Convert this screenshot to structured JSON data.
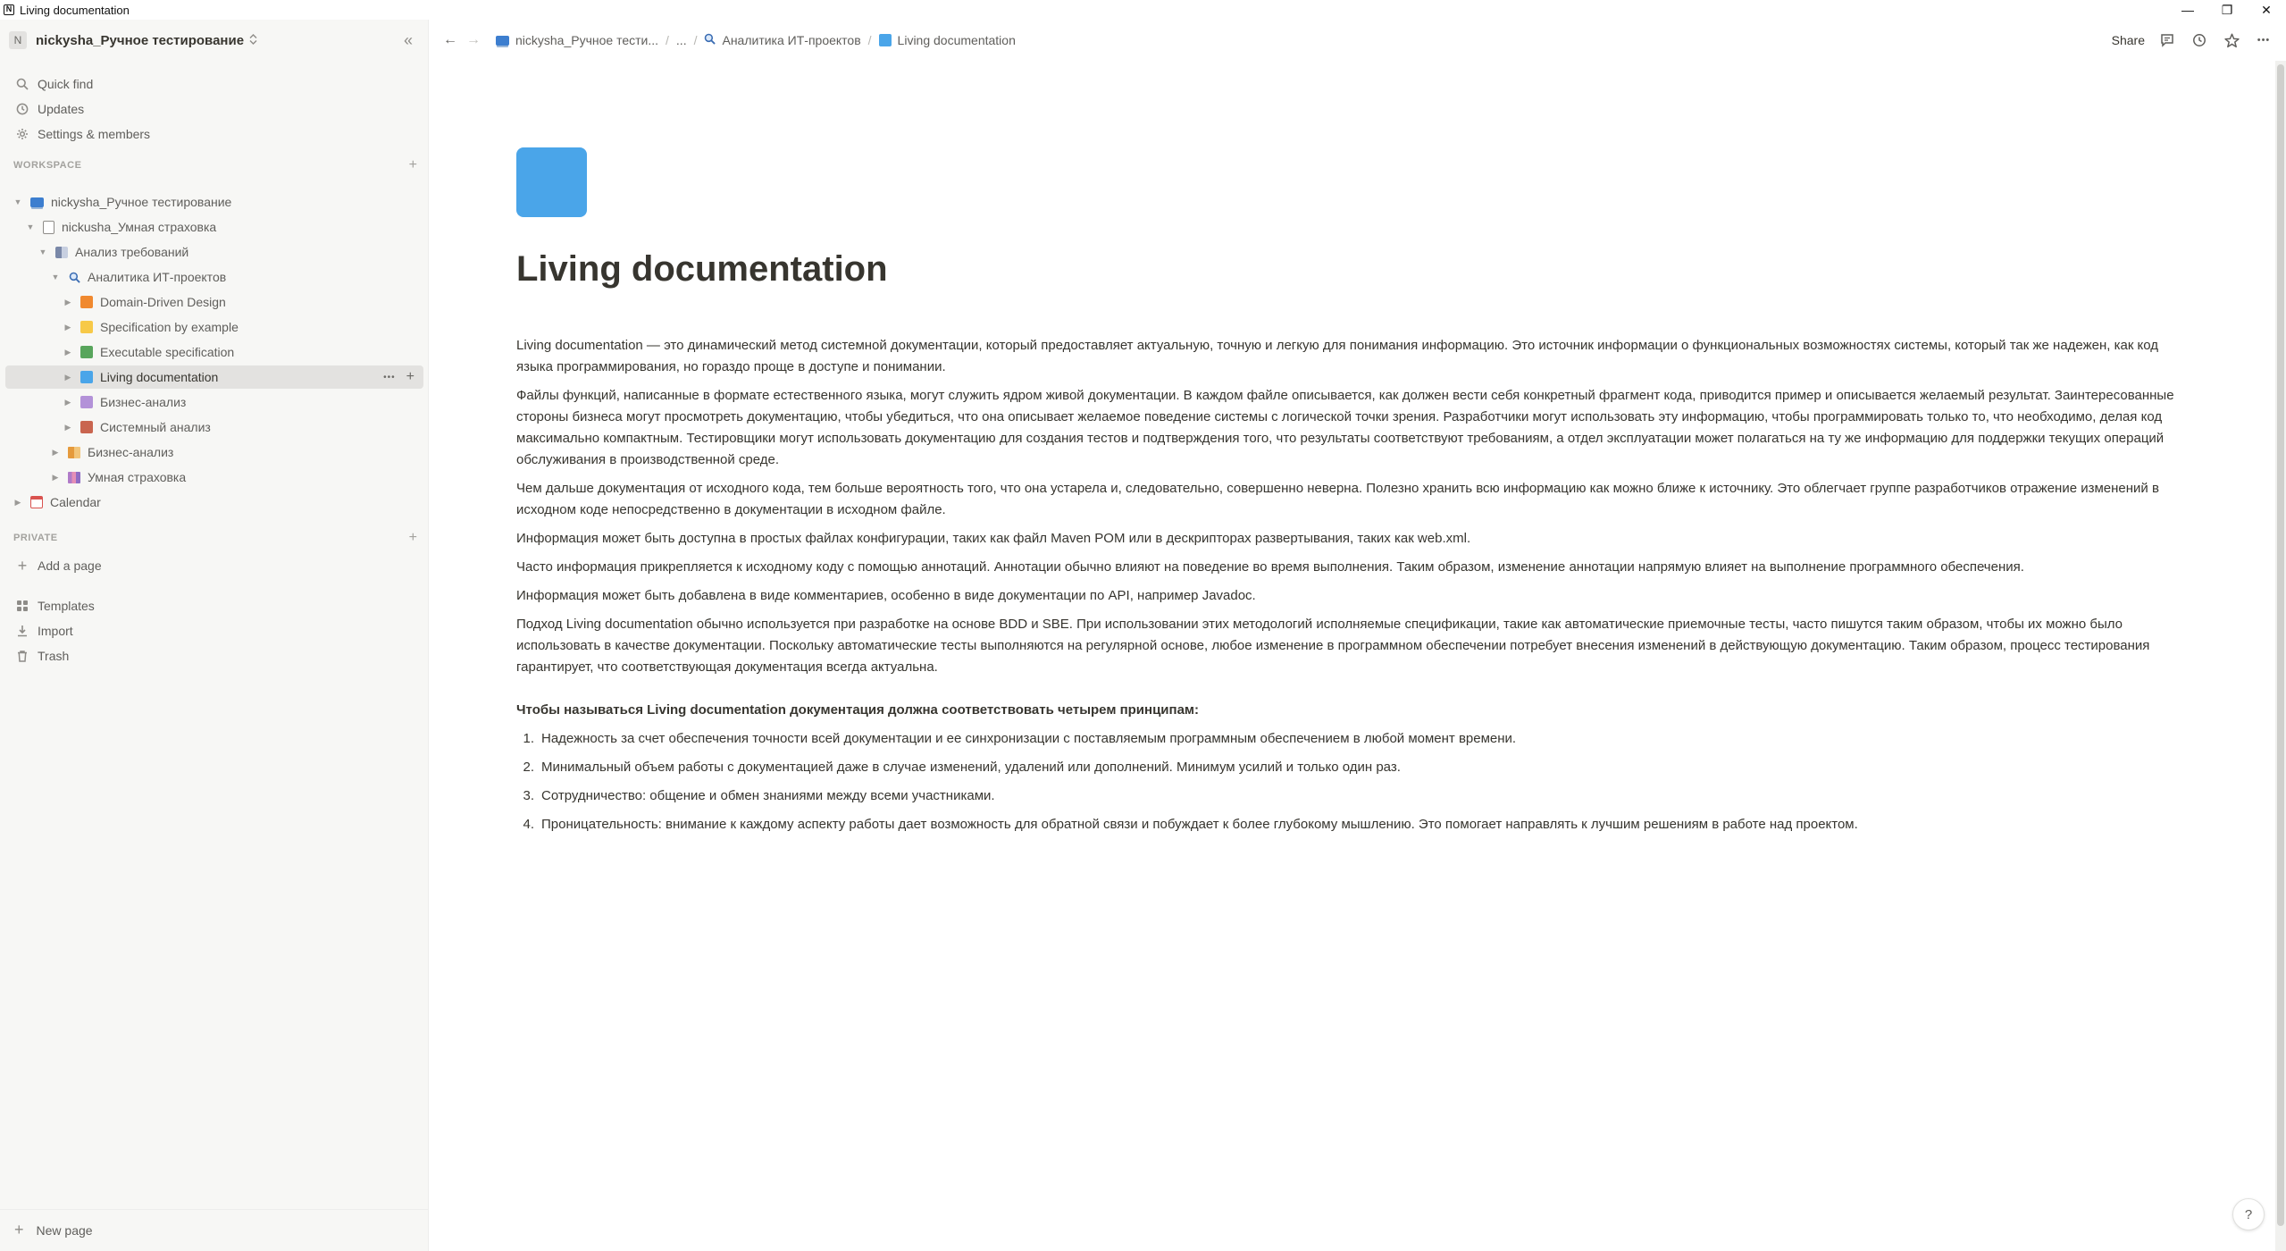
{
  "window": {
    "title": "Living documentation",
    "app_icon": "N",
    "controls": [
      "—",
      "❐",
      "✕"
    ]
  },
  "sidebar": {
    "workspace": {
      "avatar": "N",
      "name": "nickysha_Ручное тестирование",
      "chevron": "⌃⌄"
    },
    "collapse_icon": "«",
    "top_items": [
      {
        "label": "Quick find",
        "icon": "search-icon"
      },
      {
        "label": "Updates",
        "icon": "clock-icon"
      },
      {
        "label": "Settings & members",
        "icon": "gear-icon"
      }
    ],
    "workspace_section": {
      "label": "WORKSPACE",
      "plus": "+"
    },
    "tree": [
      {
        "label": "nickysha_Ручное тестирование"
      },
      {
        "label": "nickusha_Умная страховка"
      },
      {
        "label": "Анализ требований"
      },
      {
        "label": "Аналитика ИТ-проектов"
      },
      {
        "label": "Domain-Driven Design",
        "color": "#f0892f"
      },
      {
        "label": "Specification by example",
        "color": "#f7c948"
      },
      {
        "label": "Executable specification",
        "color": "#58a55c"
      },
      {
        "label": "Living documentation",
        "color": "#4aa5e9"
      },
      {
        "label": "Бизнес-анализ",
        "color": "#b392d8"
      },
      {
        "label": "Системный анализ",
        "color": "#c9654f"
      },
      {
        "label": "Бизнес-анализ"
      },
      {
        "label": "Умная страховка"
      },
      {
        "label": "Calendar"
      }
    ],
    "selected_actions": {
      "more": "•••",
      "add": "+"
    },
    "private_section": {
      "label": "PRIVATE",
      "plus": "+"
    },
    "add_page": {
      "label": "Add a page",
      "icon": "+"
    },
    "bottom_items": [
      {
        "label": "Templates",
        "icon": "templates-icon"
      },
      {
        "label": "Import",
        "icon": "import-icon"
      },
      {
        "label": "Trash",
        "icon": "trash-icon"
      }
    ],
    "new_page": {
      "label": "New page",
      "icon": "+"
    }
  },
  "topbar": {
    "back": "←",
    "forward": "→",
    "breadcrumbs": [
      {
        "label": "nickysha_Ручное тести..."
      },
      {
        "label": "..."
      },
      {
        "label": "Аналитика ИТ-проектов"
      },
      {
        "label": "Living documentation"
      }
    ],
    "separator": "/",
    "share": "Share",
    "icons": [
      "comment-icon",
      "history-icon",
      "star-icon",
      "more-icon"
    ],
    "icon_glyphs": [
      "▭",
      "◷",
      "☆",
      "•••"
    ]
  },
  "page": {
    "icon_color": "#4aa5e9",
    "title": "Living documentation",
    "paragraphs": [
      "Living documentation — это динамический метод системной документации, который предоставляет актуальную, точную и легкую для понимания информацию. Это источник информации о функциональных возможностях системы, который так же надежен, как код языка программирования, но гораздо проще в доступе и понимании.",
      "Файлы функций, написанные в формате естественного языка, могут служить ядром живой документации. В каждом файле описывается, как должен вести себя конкретный фрагмент кода, приводится пример и описывается желаемый результат. Заинтересованные стороны бизнеса могут просмотреть документацию, чтобы убедиться, что она описывает желаемое поведение системы с логической точки зрения. Разработчики могут использовать эту информацию, чтобы программировать только то, что необходимо, делая код максимально компактным. Тестировщики могут использовать документацию для создания тестов и подтверждения того, что результаты соответствуют требованиям, а отдел эксплуатации может полагаться на ту же информацию для поддержки текущих операций обслуживания в производственной среде.",
      "Чем дальше документация от исходного кода, тем больше вероятность того, что она устарела и, следовательно, совершенно неверна. Полезно хранить всю информацию как можно ближе к источнику. Это облегчает группе разработчиков отражение изменений в исходном коде непосредственно в документации в исходном файле.",
      "Информация может быть доступна в простых файлах конфигурации, таких как файл Maven POM или в дескрипторах развертывания, таких как web.xml.",
      "Часто информация прикрепляется к исходному коду с помощью аннотаций. Аннотации обычно влияют на поведение во время выполнения. Таким образом, изменение аннотации напрямую влияет на выполнение программного обеспечения.",
      "Информация может быть добавлена в виде комментариев, особенно в виде документации по API, например Javadoc.",
      "Подход Living documentation обычно используется при разработке на основе BDD и SBE. При использовании этих методологий исполняемые спецификации, такие как автоматические приемочные тесты, часто пишутся таким образом, чтобы их можно было использовать в качестве документации. Поскольку автоматические тесты выполняются на регулярной основе, любое изменение в программном обеспечении потребует внесения изменений в действующую документацию. Таким образом, процесс тестирования гарантирует, что соответствующая документация всегда актуальна."
    ],
    "principles_heading": "Чтобы называться Living documentation документация должна соответствовать четырем принципам:",
    "principles": [
      {
        "num": "1.",
        "text": "Надежность за счет обеспечения точности всей документации и ее синхронизации с поставляемым программным обеспечением в любой момент времени."
      },
      {
        "num": "2.",
        "text": "Минимальный объем работы с документацией даже в случае изменений, удалений или дополнений. Минимум усилий и только один раз."
      },
      {
        "num": "3.",
        "text": "Сотрудничество: общение и обмен знаниями между всеми участниками."
      },
      {
        "num": "4.",
        "text": "Проницательность: внимание к каждому аспекту работы дает возможность для обратной связи и побуждает к более глубокому мышлению. Это помогает направлять к лучшим решениям в работе над проектом."
      }
    ]
  },
  "help": {
    "label": "?"
  }
}
